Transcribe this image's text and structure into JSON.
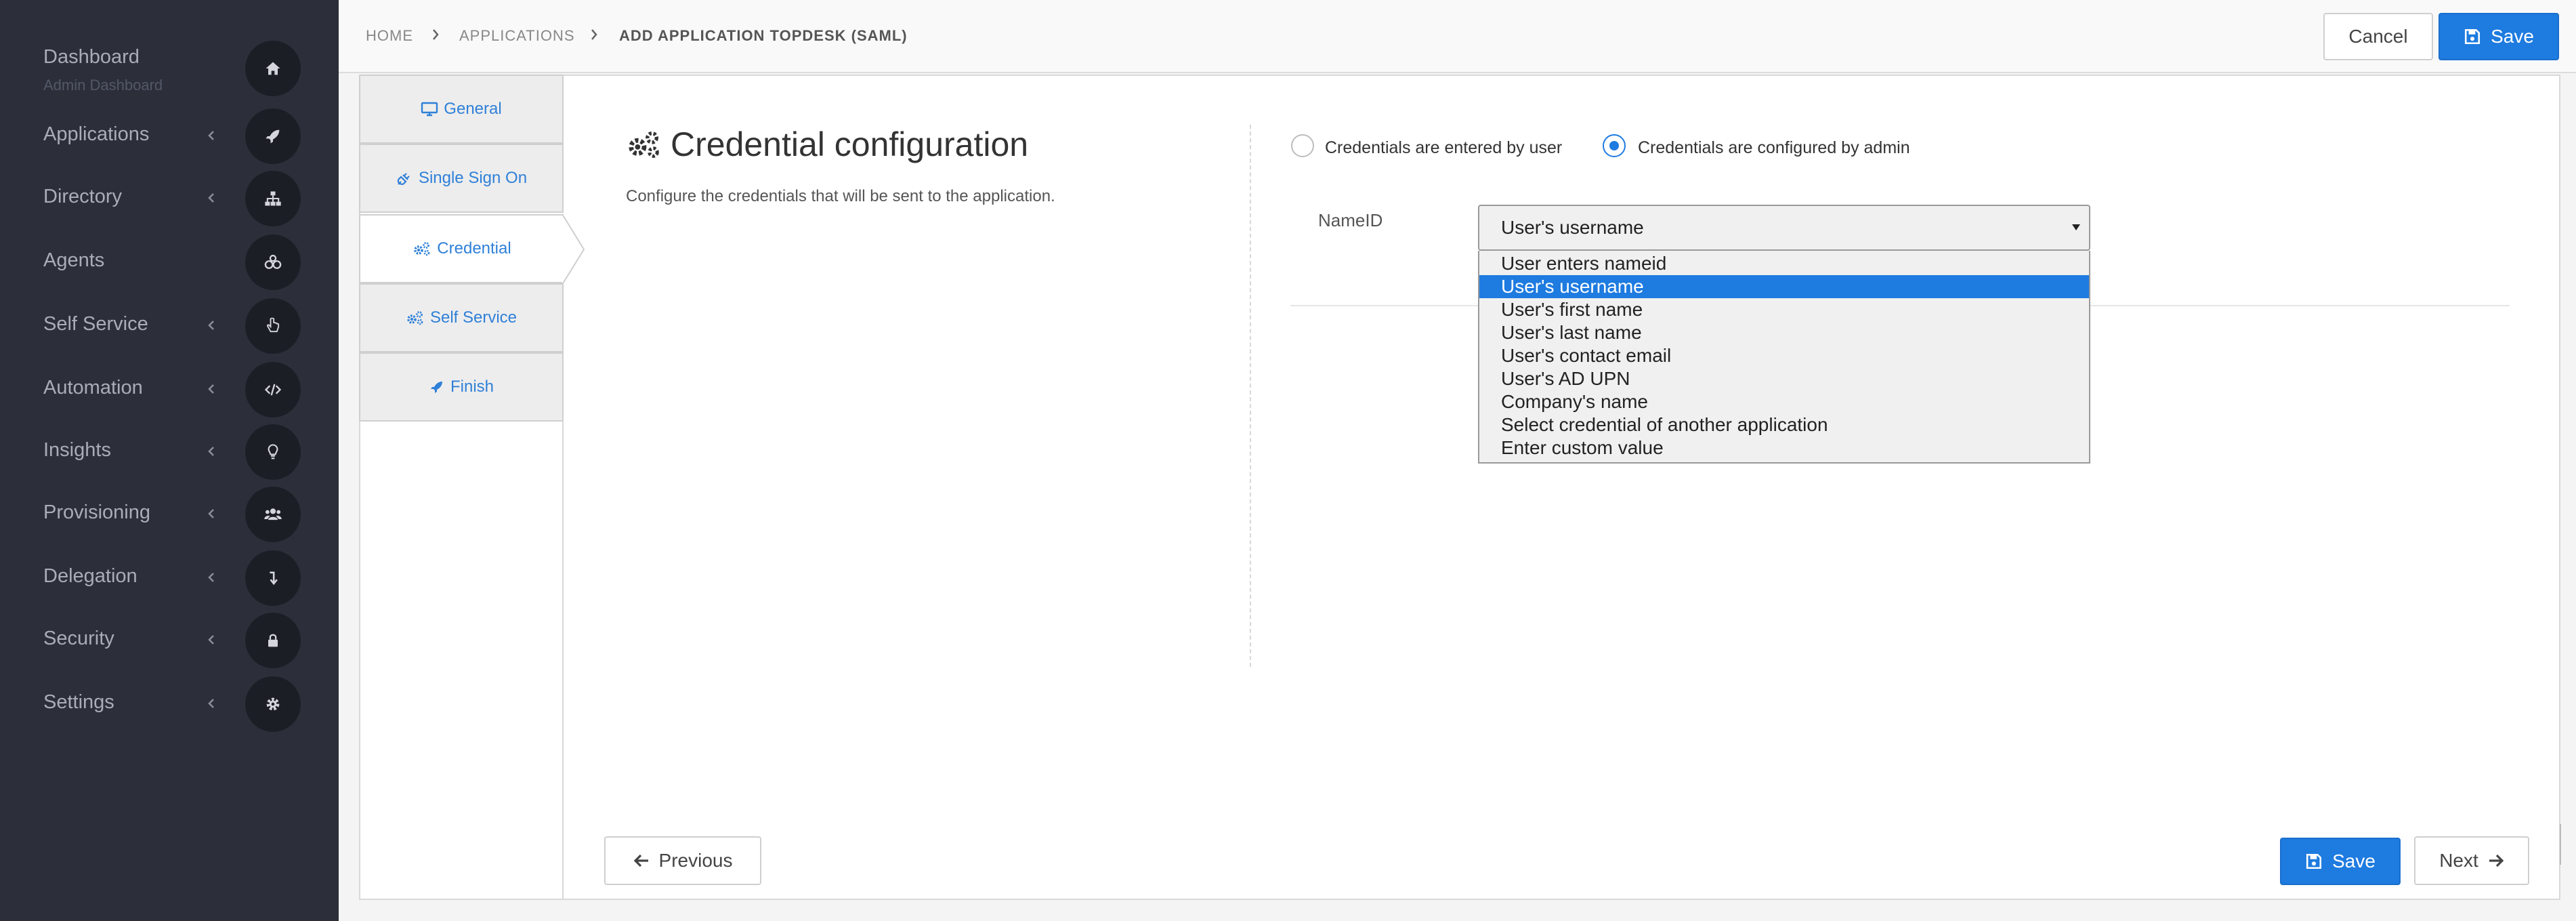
{
  "sidebar": {
    "items": [
      {
        "label": "Dashboard",
        "sub": "Admin Dashboard",
        "icon": "home-icon",
        "has_chevron": false
      },
      {
        "label": "Applications",
        "icon": "rocket-icon",
        "has_chevron": true
      },
      {
        "label": "Directory",
        "icon": "sitemap-icon",
        "has_chevron": true
      },
      {
        "label": "Agents",
        "icon": "agents-icon",
        "has_chevron": false
      },
      {
        "label": "Self Service",
        "icon": "hand-pointer-icon",
        "has_chevron": true
      },
      {
        "label": "Automation",
        "icon": "code-icon",
        "has_chevron": true
      },
      {
        "label": "Insights",
        "icon": "lightbulb-icon",
        "has_chevron": true
      },
      {
        "label": "Provisioning",
        "icon": "users-icon",
        "has_chevron": true
      },
      {
        "label": "Delegation",
        "icon": "level-down-icon",
        "has_chevron": true
      },
      {
        "label": "Security",
        "icon": "lock-icon",
        "has_chevron": true
      },
      {
        "label": "Settings",
        "icon": "gear-icon",
        "has_chevron": true
      }
    ]
  },
  "breadcrumb": {
    "items": [
      "HOME",
      "APPLICATIONS",
      "ADD APPLICATION TOPDESK (SAML)"
    ]
  },
  "header": {
    "cancel_label": "Cancel",
    "save_label": "Save"
  },
  "wizard": {
    "tabs": [
      {
        "label": "General",
        "icon": "desktop-icon",
        "active": false
      },
      {
        "label": "Single Sign On",
        "icon": "plug-icon",
        "active": false
      },
      {
        "label": "Credential",
        "icon": "cogs-icon",
        "active": true
      },
      {
        "label": "Self Service",
        "icon": "cogs-icon",
        "active": false
      },
      {
        "label": "Finish",
        "icon": "rocket-icon",
        "active": false
      }
    ]
  },
  "section": {
    "title": "Credential configuration",
    "description": "Configure the credentials that will be sent to the application."
  },
  "credential_mode": {
    "options": [
      "Credentials are entered by user",
      "Credentials are configured by admin"
    ],
    "selected": "Credentials are configured by admin"
  },
  "nameid": {
    "label": "NameID",
    "value": "User's username",
    "options": [
      "User enters nameid",
      "User's username",
      "User's first name",
      "User's last name",
      "User's contact email",
      "User's AD UPN",
      "Company's name",
      "Select credential of another application",
      "Enter custom value"
    ]
  },
  "footer": {
    "previous_label": "Previous",
    "save_label": "Save",
    "next_label": "Next"
  },
  "colors": {
    "sidebar_bg": "#2c2f3a",
    "accent": "#1e7be0",
    "link": "#2f80d8"
  }
}
